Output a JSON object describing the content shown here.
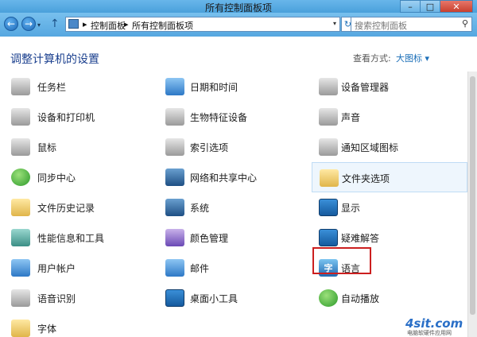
{
  "window": {
    "title": "所有控制面板项"
  },
  "window_controls": {
    "minimize": "–",
    "maximize": "□",
    "close": "✕"
  },
  "nav": {
    "back": "←",
    "forward": "→",
    "up": "↑",
    "breadcrumbs": [
      "控制面板",
      "所有控制面板项"
    ],
    "separator": "▸",
    "refresh": "↻",
    "search_placeholder": "搜索控制面板"
  },
  "header": {
    "title": "调整计算机的设置",
    "view_label": "查看方式:",
    "view_value": "大图标 ▾"
  },
  "items": [
    {
      "label": "任务栏",
      "icon": "taskbar-icon",
      "theme": "c-gray"
    },
    {
      "label": "日期和时间",
      "icon": "calendar-clock-icon",
      "theme": "c-blue"
    },
    {
      "label": "设备管理器",
      "icon": "device-manager-icon",
      "theme": "c-gray"
    },
    {
      "label": "设备和打印机",
      "icon": "printer-icon",
      "theme": "c-gray"
    },
    {
      "label": "生物特征设备",
      "icon": "fingerprint-icon",
      "theme": "c-gray"
    },
    {
      "label": "声音",
      "icon": "speaker-icon",
      "theme": "c-gray"
    },
    {
      "label": "鼠标",
      "icon": "mouse-icon",
      "theme": "c-gray"
    },
    {
      "label": "索引选项",
      "icon": "index-search-icon",
      "theme": "c-gray"
    },
    {
      "label": "通知区域图标",
      "icon": "notification-area-icon",
      "theme": "c-gray"
    },
    {
      "label": "同步中心",
      "icon": "sync-icon",
      "theme": "c-green"
    },
    {
      "label": "网络和共享中心",
      "icon": "network-icon",
      "theme": "c-dark"
    },
    {
      "label": "文件夹选项",
      "icon": "folder-options-icon",
      "theme": "c-yellow"
    },
    {
      "label": "文件历史记录",
      "icon": "file-history-icon",
      "theme": "c-yellow"
    },
    {
      "label": "系统",
      "icon": "system-icon",
      "theme": "c-dark"
    },
    {
      "label": "显示",
      "icon": "display-icon",
      "theme": "c-mon"
    },
    {
      "label": "性能信息和工具",
      "icon": "performance-icon",
      "theme": "c-teal"
    },
    {
      "label": "颜色管理",
      "icon": "color-management-icon",
      "theme": "c-purple"
    },
    {
      "label": "疑难解答",
      "icon": "troubleshooting-icon",
      "theme": "c-mon"
    },
    {
      "label": "用户帐户",
      "icon": "user-accounts-icon",
      "theme": "c-blue"
    },
    {
      "label": "邮件",
      "icon": "mail-icon",
      "theme": "c-blue"
    },
    {
      "label": "语言",
      "icon": "language-icon",
      "theme": "c-lang",
      "glyph": "字"
    },
    {
      "label": "语音识别",
      "icon": "microphone-icon",
      "theme": "c-gray"
    },
    {
      "label": "桌面小工具",
      "icon": "desktop-gadgets-icon",
      "theme": "c-mon"
    },
    {
      "label": "自动播放",
      "icon": "autoplay-icon",
      "theme": "c-green"
    },
    {
      "label": "字体",
      "icon": "fonts-icon",
      "theme": "c-yellow"
    }
  ],
  "highlighted_item": "文件夹选项",
  "boxed_item": "语言",
  "watermark": {
    "logo": "4sit.com",
    "subtitle": "电脑软硬件应用网"
  }
}
